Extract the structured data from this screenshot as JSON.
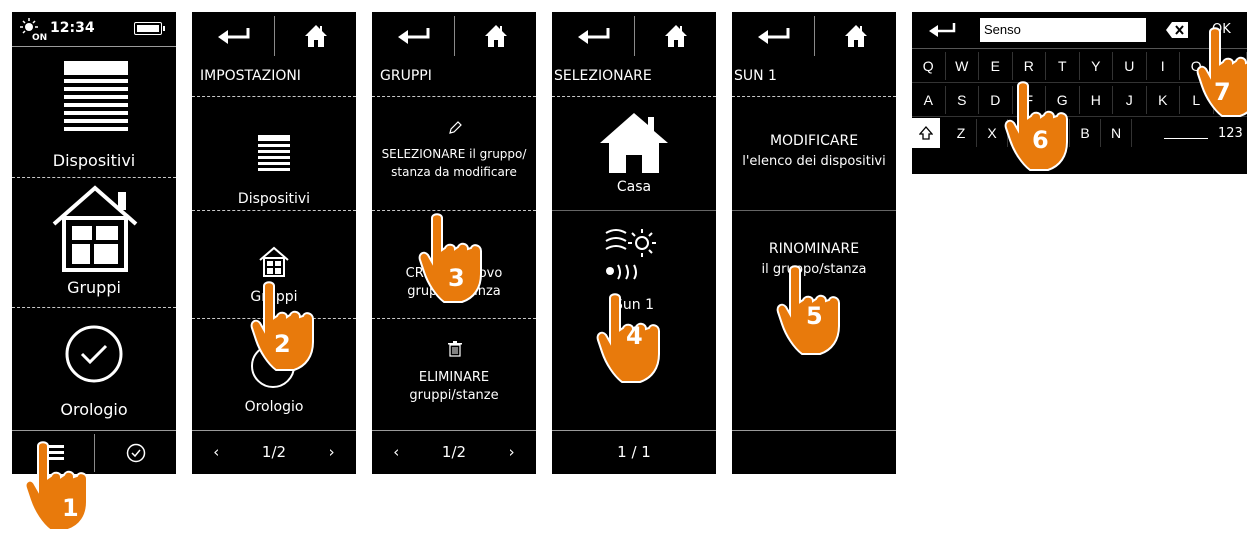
{
  "screen1": {
    "time": "12:34",
    "items": [
      "Dispositivi",
      "Gruppi",
      "Orologio"
    ]
  },
  "screen2": {
    "title": "IMPOSTAZIONI",
    "items": [
      "Dispositivi",
      "Gruppi",
      "Orologio"
    ],
    "page": "1/2"
  },
  "screen3": {
    "title": "GRUPPI",
    "select_line1": "SELEZIONARE il gruppo/",
    "select_line2": "stanza da modificare",
    "create_line1": "CREARE nuovo",
    "create_line2": "gruppo/stanza",
    "delete_line1": "ELIMINARE",
    "delete_line2": "gruppi/stanze",
    "page": "1/2"
  },
  "screen4": {
    "title": "SELEZIONARE",
    "items": [
      "Casa",
      "Sun 1"
    ],
    "page": "1 / 1"
  },
  "screen5": {
    "title": "SUN 1",
    "modify_line1": "MODIFICARE",
    "modify_line2": "l'elenco dei dispositivi",
    "rename_line1": "RINOMINARE",
    "rename_line2": "il gruppo/stanza"
  },
  "keyboard": {
    "input_value": "Senso",
    "ok": "OK",
    "row1": [
      "Q",
      "W",
      "E",
      "R",
      "T",
      "Y",
      "U",
      "I",
      "O",
      "P"
    ],
    "row2": [
      "A",
      "S",
      "D",
      "F",
      "G",
      "H",
      "J",
      "K",
      "L"
    ],
    "row3": [
      "Z",
      "X",
      "C",
      "V",
      "B",
      "N"
    ],
    "numbers_key": "123"
  },
  "steps": [
    "1",
    "2",
    "3",
    "4",
    "5",
    "6",
    "7"
  ],
  "colors": {
    "screen_bg": "#000000",
    "hand_orange": "#e87a0c",
    "separator": "#9a9a9a"
  }
}
